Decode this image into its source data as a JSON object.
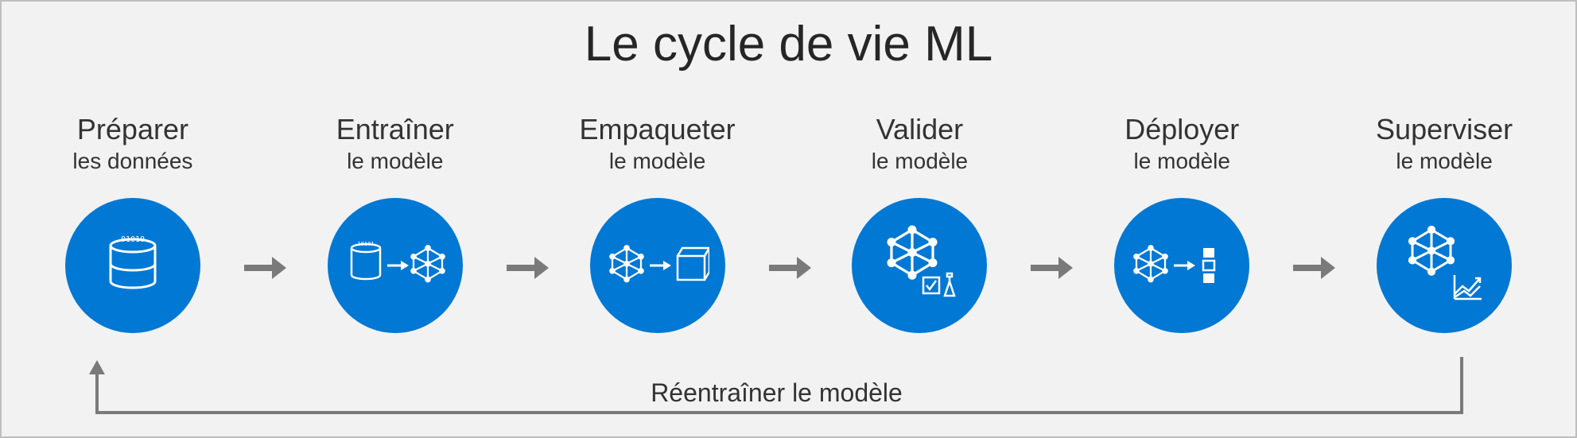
{
  "title": "Le cycle de vie ML",
  "steps": [
    {
      "line1": "Préparer",
      "line2": "les données",
      "icon": "data-prepare-icon"
    },
    {
      "line1": "Entraîner",
      "line2": "le modèle",
      "icon": "data-to-model-icon"
    },
    {
      "line1": "Empaqueter",
      "line2": "le modèle",
      "icon": "model-to-package-icon"
    },
    {
      "line1": "Valider",
      "line2": "le modèle",
      "icon": "model-validate-icon"
    },
    {
      "line1": "Déployer",
      "line2": "le modèle",
      "icon": "model-deploy-icon"
    },
    {
      "line1": "Superviser",
      "line2": "le modèle",
      "icon": "model-monitor-icon"
    }
  ],
  "feedback_label": "Réentraîner le modèle",
  "colors": {
    "circle": "#0078d4",
    "arrow": "#7a7a7a",
    "bg": "#f2f2f2"
  }
}
